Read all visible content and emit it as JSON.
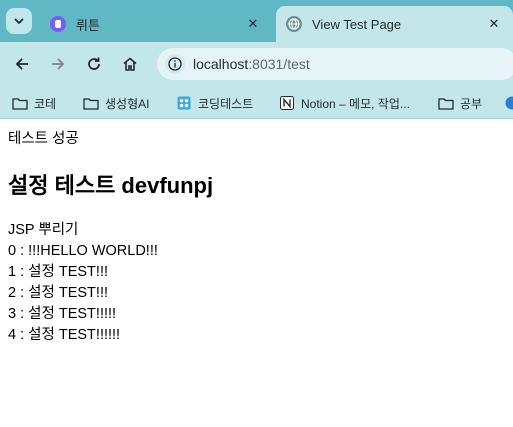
{
  "tabs": [
    {
      "title": "뤼튼",
      "active": false,
      "favicon": "wrtn-icon"
    },
    {
      "title": "View Test Page",
      "active": true,
      "favicon": "globe-icon"
    }
  ],
  "toolbar": {
    "url_host": "localhost",
    "url_rest": ":8031/test"
  },
  "bookmarks": [
    {
      "label": "코테",
      "icon": "folder-icon"
    },
    {
      "label": "생성형AI",
      "icon": "folder-icon"
    },
    {
      "label": "코딩테스트",
      "icon": "grid-icon"
    },
    {
      "label": "Notion – 메모, 작업...",
      "icon": "notion-icon"
    },
    {
      "label": "공부",
      "icon": "folder-icon"
    }
  ],
  "page": {
    "status": "테스트 성공",
    "heading": "설정 테스트 devfunpj",
    "subtitle": "JSP 뿌리기",
    "items": [
      "0 : !!!HELLO WORLD!!!",
      "1 : 설정 TEST!!!",
      "2 : 설정 TEST!!!",
      "3 : 설정 TEST!!!!!",
      "4 : 설정 TEST!!!!!!"
    ]
  },
  "colors": {
    "tabstrip": "#5fb8c4",
    "toolbar": "#c3e6ea"
  }
}
